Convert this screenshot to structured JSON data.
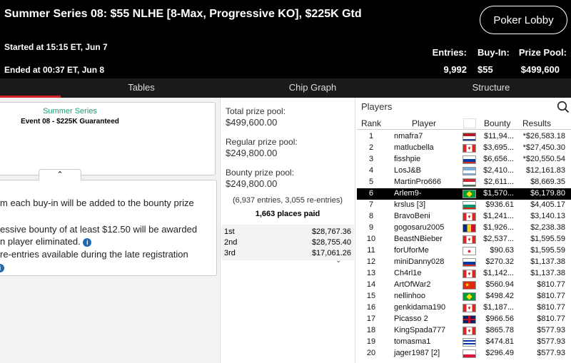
{
  "header": {
    "title": "Summer Series 08: $55 NLHE [8-Max, Progressive KO], $225K Gtd",
    "started": "Started at 15:15 ET, Jun 7",
    "ended": "Ended at 00:37 ET, Jun 8",
    "lobby_button": "Poker Lobby",
    "entries_label": "Entries:",
    "entries_value": "9,992",
    "buyin_label": "Buy-In:",
    "buyin_value": "$55",
    "prize_label": "Prize Pool:",
    "prize_value": "$499,600"
  },
  "tabs": [
    "Tables",
    "Chip Graph",
    "Structure"
  ],
  "event_card": {
    "series": "Summer Series",
    "event": "Event 08 - $225K Guaranteed"
  },
  "info": {
    "line1": "m each buy-in will be added to the bounty prize",
    "line2": "essive bounty of at least $12.50 will be awarded",
    "line3": "n player eliminated.",
    "line4": "re-entries available during the late registration"
  },
  "prize": {
    "total_label": "Total prize pool:",
    "total_value": "$499,600.00",
    "regular_label": "Regular prize pool:",
    "regular_value": "$249,800.00",
    "bounty_label": "Bounty prize pool:",
    "bounty_value": "$249,800.00",
    "entries_note": "(6,937 entries, 3,055 re-entries)",
    "places_paid": "1,663 places paid",
    "payouts": [
      {
        "place": "1st",
        "amount": "$28,767.36"
      },
      {
        "place": "2nd",
        "amount": "$28,755.40"
      },
      {
        "place": "3rd",
        "amount": "$17,061.26"
      }
    ]
  },
  "players": {
    "title": "Players",
    "columns": {
      "rank": "Rank",
      "player": "Player",
      "bounty": "Bounty",
      "results": "Results"
    },
    "selected_rank": 6,
    "rows": [
      {
        "rank": "1",
        "player": "nmafra7",
        "flag": "NL",
        "bounty": "$11,94...",
        "results": "*$26,583.18"
      },
      {
        "rank": "2",
        "player": "matlucbella",
        "flag": "CA",
        "bounty": "$3,695...",
        "results": "*$27,450.30"
      },
      {
        "rank": "3",
        "player": "fisshpie",
        "flag": "RU",
        "bounty": "$6,656...",
        "results": "*$20,550.54"
      },
      {
        "rank": "4",
        "player": "LosJ&B",
        "flag": "AR",
        "bounty": "$2,410...",
        "results": "$12,161.83"
      },
      {
        "rank": "5",
        "player": "MartinPro666",
        "flag": "HU",
        "bounty": "$2,611...",
        "results": "$8,669.35"
      },
      {
        "rank": "6",
        "player": "Arlem9-",
        "flag": "BR",
        "bounty": "$1,570...",
        "results": "$6,179.80"
      },
      {
        "rank": "7",
        "player": "krslus [3]",
        "flag": "BG",
        "bounty": "$936.61",
        "results": "$4,405.17"
      },
      {
        "rank": "8",
        "player": "BravoBeni",
        "flag": "CA",
        "bounty": "$1,241...",
        "results": "$3,140.13"
      },
      {
        "rank": "9",
        "player": "gogosaru2005",
        "flag": "RO",
        "bounty": "$1,926...",
        "results": "$2,238.38"
      },
      {
        "rank": "10",
        "player": "BeastNBieber",
        "flag": "CA",
        "bounty": "$2,537...",
        "results": "$1,595.59"
      },
      {
        "rank": "11",
        "player": "forUforMe",
        "flag": "KR",
        "bounty": "$90.63",
        "results": "$1,595.59"
      },
      {
        "rank": "12",
        "player": "miniDanny028",
        "flag": "RU",
        "bounty": "$270.32",
        "results": "$1,137.38"
      },
      {
        "rank": "13",
        "player": "Ch4rl1e",
        "flag": "CA",
        "bounty": "$1,142...",
        "results": "$1,137.38"
      },
      {
        "rank": "14",
        "player": "ArtOfWar2",
        "flag": "CN",
        "bounty": "$560.94",
        "results": "$810.77"
      },
      {
        "rank": "15",
        "player": "nellinhoo",
        "flag": "BR",
        "bounty": "$498.42",
        "results": "$810.77"
      },
      {
        "rank": "16",
        "player": "genkidama190",
        "flag": "CA",
        "bounty": "$1,187...",
        "results": "$810.77"
      },
      {
        "rank": "17",
        "player": "Picasso 2",
        "flag": "GB",
        "bounty": "$966.56",
        "results": "$810.77"
      },
      {
        "rank": "18",
        "player": "KingSpada777",
        "flag": "CA",
        "bounty": "$865.78",
        "results": "$577.93"
      },
      {
        "rank": "19",
        "player": "tomasma1",
        "flag": "UY",
        "bounty": "$474.81",
        "results": "$577.93"
      },
      {
        "rank": "20",
        "player": "jager1987 [2]",
        "flag": "PL",
        "bounty": "$296.49",
        "results": "$577.93"
      }
    ]
  },
  "colors": {
    "accent_red": "#d2232a",
    "series_green": "#1b9e77",
    "info_blue": "#1c6bb0"
  }
}
